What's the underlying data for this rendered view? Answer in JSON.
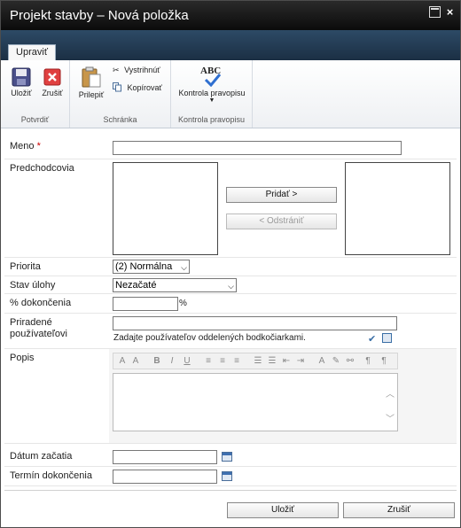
{
  "window": {
    "title": "Projekt stavby – Nová položka"
  },
  "ribbon": {
    "tab": "Upraviť",
    "groups": {
      "commit": {
        "label": "Potvrdiť",
        "save": "Uložiť",
        "cancel": "Zrušiť"
      },
      "clipboard": {
        "label": "Schránka",
        "paste": "Prilepiť",
        "cut": "Vystrihnúť",
        "copy": "Kopírovať"
      },
      "spelling": {
        "label": "Kontrola pravopisu",
        "spell": "Kontrola pravopisu",
        "abc": "ABC"
      }
    }
  },
  "form": {
    "name": {
      "label": "Meno",
      "required": "*",
      "value": ""
    },
    "predecessors": {
      "label": "Predchodcovia",
      "add": "Pridať >",
      "remove": "< Odstrániť"
    },
    "priority": {
      "label": "Priorita",
      "value": "(2) Normálna"
    },
    "status": {
      "label": "Stav úlohy",
      "value": "Nezačaté"
    },
    "percent": {
      "label": "% dokončenia",
      "value": "",
      "unit": "%"
    },
    "assigned": {
      "label_line1": "Priradené",
      "label_line2": "používateľovi",
      "value": "",
      "hint": "Zadajte používateľov oddelených bodkočiarkami."
    },
    "description": {
      "label": "Popis",
      "value": ""
    },
    "start_date": {
      "label": "Dátum začatia",
      "value": ""
    },
    "due_date": {
      "label": "Termín dokončenia",
      "value": ""
    }
  },
  "footer": {
    "save": "Uložiť",
    "cancel": "Zrušiť"
  }
}
